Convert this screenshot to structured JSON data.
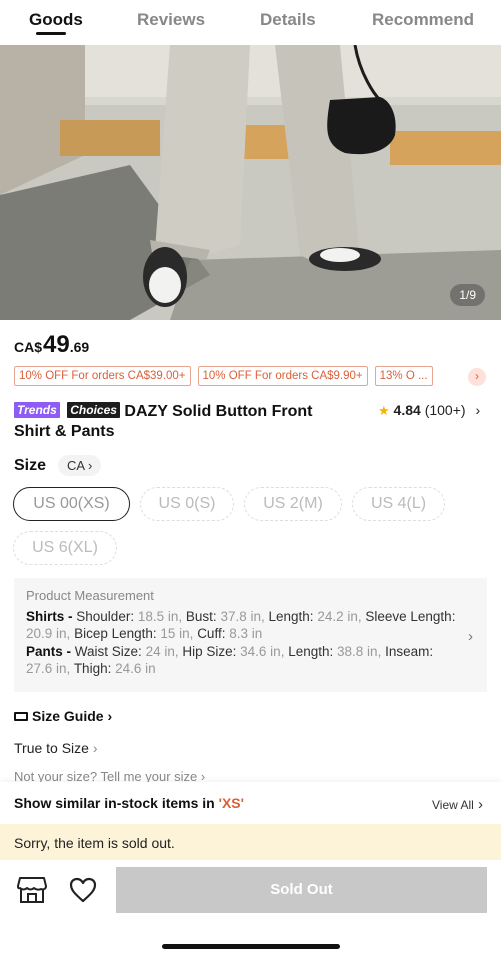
{
  "tabs": [
    {
      "label": "Goods",
      "active": true
    },
    {
      "label": "Reviews",
      "active": false
    },
    {
      "label": "Details",
      "active": false
    },
    {
      "label": "Recommend",
      "active": false
    }
  ],
  "gallery": {
    "counter": "1/9"
  },
  "price": {
    "currency": "CA$",
    "integer": "49",
    "decimal": ".69"
  },
  "coupons": [
    "10% OFF For orders CA$39.00+",
    "10% OFF For orders CA$9.90+",
    "13% O ..."
  ],
  "coupon_more_icon": "chevron-right-icon",
  "badges": {
    "trends": "Trends",
    "choices": "Choices"
  },
  "product": {
    "title": "DAZY Solid Button Front Shirt & Pants"
  },
  "rating": {
    "value": "4.84",
    "count": "(100+)"
  },
  "size": {
    "label": "Size",
    "region": "CA",
    "options": [
      {
        "label": "US 00(XS)",
        "selected": true
      },
      {
        "label": "US 0(S)",
        "selected": false
      },
      {
        "label": "US 2(M)",
        "selected": false
      },
      {
        "label": "US 4(L)",
        "selected": false
      },
      {
        "label": "US 6(XL)",
        "selected": false
      }
    ]
  },
  "measurement": {
    "title": "Product Measurement",
    "shirts_label": "Shirts -",
    "shirts": [
      {
        "k": "Shoulder:",
        "v": "18.5 in,"
      },
      {
        "k": "Bust:",
        "v": "37.8 in,"
      },
      {
        "k": "Length:",
        "v": "24.2 in,"
      },
      {
        "k": "Sleeve Length:",
        "v": "20.9 in,"
      },
      {
        "k": "Bicep Length:",
        "v": "15 in,"
      },
      {
        "k": "Cuff:",
        "v": "8.3 in"
      }
    ],
    "pants_label": "Pants -",
    "pants": [
      {
        "k": "Waist Size:",
        "v": "24 in,"
      },
      {
        "k": "Hip Size:",
        "v": "34.6 in,"
      },
      {
        "k": "Length:",
        "v": "38.8 in,"
      },
      {
        "k": "Inseam:",
        "v": "27.6 in,"
      },
      {
        "k": "Thigh:",
        "v": "24.6 in"
      }
    ]
  },
  "links": {
    "size_guide": "Size Guide",
    "true_to_size": "True to Size",
    "not_your_size": "Not your size? Tell me your size"
  },
  "similar": {
    "prefix": "Show similar in-stock items in",
    "size": "'XS'",
    "view_all": "View All"
  },
  "soldout_banner": "Sorry, the item is sold out.",
  "action": {
    "button": "Sold Out"
  },
  "colors": {
    "accent": "#d9603a",
    "badge_trends": "#8e5cf4",
    "badge_choices": "#1d1d1d",
    "star": "#f5b400",
    "banner": "#fcf3d9",
    "button_disabled": "#c8c8c8"
  }
}
